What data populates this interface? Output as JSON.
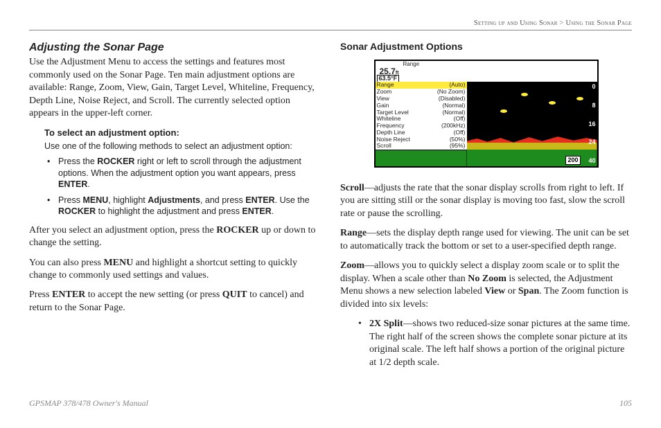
{
  "breadcrumb": {
    "part1": "Setting up and Using Sonar",
    "sep": ">",
    "part2": "Using the Sonar Page"
  },
  "left": {
    "heading": "Adjusting the Sonar Page",
    "intro": "Use the Adjustment Menu to access the settings and features most commonly used on the Sonar Page. Ten main adjustment options are available: Range, Zoom, View, Gain, Target Level, Whiteline, Frequency, Depth Line, Noise Reject, and Scroll. The currently selected option appears in the upper-left corner.",
    "proc_heading": "To select an adjustment option:",
    "proc_lead": "Use one of the following methods to select an adjustment option:",
    "step1_a": "Press the ",
    "step1_b": "ROCKER",
    "step1_c": " right or left to scroll through the adjustment options. When the adjustment option you want appears, press ",
    "step1_d": "ENTER",
    "step1_e": ".",
    "step2_a": "Press ",
    "step2_b": "MENU",
    "step2_c": ", highlight ",
    "step2_d": "Adjustments",
    "step2_e": ", and press ",
    "step2_f": "ENTER",
    "step2_g": ". Use the ",
    "step2_h": "ROCKER",
    "step2_i": " to highlight the adjustment and press ",
    "step2_j": "ENTER",
    "step2_k": ".",
    "after_a": "After you select an adjustment option, press the ",
    "after_b": "ROCKER",
    "after_c": " up or down to change the setting.",
    "also_a": "You can also press ",
    "also_b": "MENU",
    "also_c": " and highlight a shortcut setting to quickly change to commonly used settings and values.",
    "press_a": "Press ",
    "press_b": "ENTER",
    "press_c": " to accept the new setting (or press ",
    "press_d": "QUIT",
    "press_e": " to cancel) and return to the Sonar Page."
  },
  "right": {
    "heading": "Sonar Adjustment Options",
    "scroll_b": "Scroll",
    "scroll_t": "—adjusts the rate that the sonar display scrolls from right to left. If you are sitting still or the sonar display is moving too fast, slow the scroll rate or pause the scrolling.",
    "range_b": "Range",
    "range_t": "—sets the display depth range used for viewing. The unit can be set to automatically track the bottom or set to a user-specified depth range.",
    "zoom_b": "Zoom",
    "zoom_t1": "—allows you to quickly select a display zoom scale or to split the display. When a scale other than ",
    "zoom_t2": "No Zoom",
    "zoom_t3": " is selected, the Adjustment Menu shows a new selection labeled ",
    "zoom_t4": "View",
    "zoom_t5": " or ",
    "zoom_t6": "Span",
    "zoom_t7": ". The Zoom function is divided into six levels:",
    "split_b": "2X Split",
    "split_t": "—shows two reduced-size sonar pictures at the same time. The right half of the screen shows the complete sonar picture at its original scale. The left half shows a portion of the original picture at 1/2 depth scale."
  },
  "sonar": {
    "range_label": "Range",
    "depth": "25.7",
    "depth_unit": "ft",
    "temp": "63.5°F",
    "menu": [
      {
        "k": "Range",
        "v": "(Auto)",
        "hl": true
      },
      {
        "k": "Zoom",
        "v": "(No Zoom)"
      },
      {
        "k": "View",
        "v": "(Disabled)"
      },
      {
        "k": "Gain",
        "v": "(Normal)"
      },
      {
        "k": "Target Level",
        "v": "(Normal)"
      },
      {
        "k": "Whiteline",
        "v": "(Off)"
      },
      {
        "k": "Frequency",
        "v": "(200kHz)"
      },
      {
        "k": "Depth Line",
        "v": "(Off)"
      },
      {
        "k": "Noise Reject",
        "v": "(50%)"
      },
      {
        "k": "Scroll",
        "v": "(95%)"
      }
    ],
    "ticks": [
      "0",
      "8",
      "16",
      "24",
      "40"
    ],
    "box": "200"
  },
  "footer": {
    "left": "GPSMAP 378/478 Owner's Manual",
    "right": "105"
  }
}
